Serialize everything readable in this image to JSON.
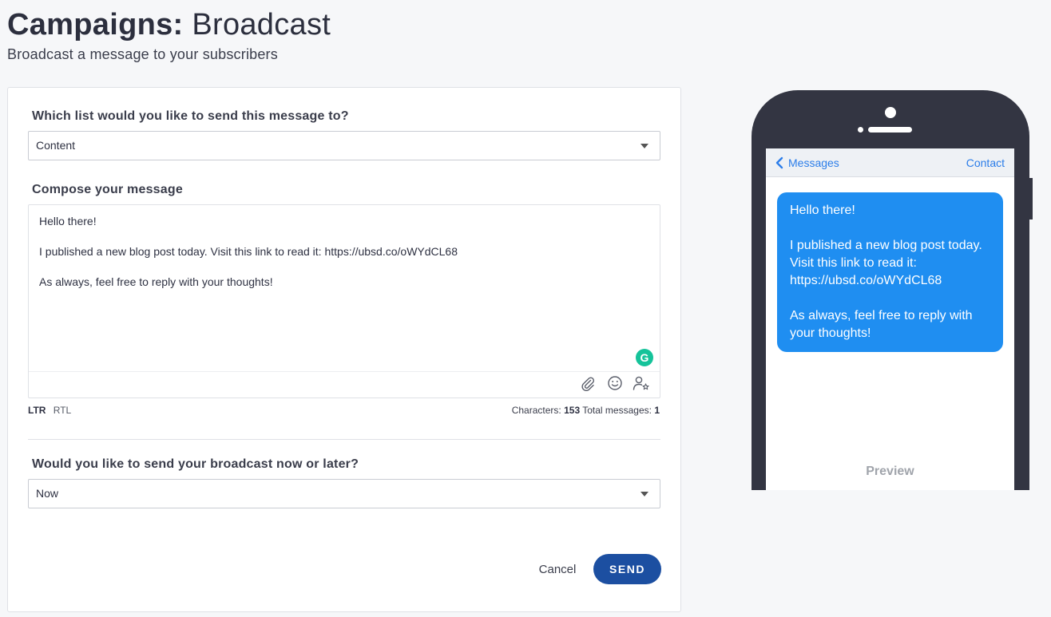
{
  "header": {
    "title_strong": "Campaigns:",
    "title_light": "Broadcast",
    "subtitle": "Broadcast a message to your subscribers"
  },
  "form": {
    "list_question": "Which list would you like to send this message to?",
    "list_selected": "Content",
    "compose_label": "Compose your message",
    "message_lines": [
      "Hello there!",
      "I published a new blog post today. Visit this link to read it: https://ubsd.co/oWYdCL68",
      "As always, feel free to reply with your thoughts!"
    ],
    "grammarly_letter": "G",
    "direction": {
      "ltr": "LTR",
      "rtl": "RTL"
    },
    "counts": {
      "characters_label": "Characters:",
      "characters_value": "153",
      "total_label": "Total messages:",
      "total_value": "1"
    },
    "schedule_question": "Would you like to send your broadcast now or later?",
    "schedule_selected": "Now",
    "cancel_label": "Cancel",
    "send_label": "SEND"
  },
  "preview": {
    "back_label": "Messages",
    "contact_label": "Contact",
    "bubble_paragraphs": [
      "Hello there!",
      "I published a new blog post today. Visit this link to read it: https://ubsd.co/oWYdCL68",
      "As always, feel free to reply with your thoughts!"
    ],
    "footer_label": "Preview"
  },
  "colors": {
    "send_button": "#1c4fa1",
    "bubble": "#1f8ef1",
    "link_blue": "#2b7de9",
    "grammarly": "#15c39a",
    "phone_body": "#333542"
  },
  "icons": {
    "attach": "paperclip-icon",
    "emoji": "smiley-icon",
    "personalize": "user-star-icon",
    "back": "chevron-left-icon",
    "dropdown": "caret-down-icon"
  }
}
